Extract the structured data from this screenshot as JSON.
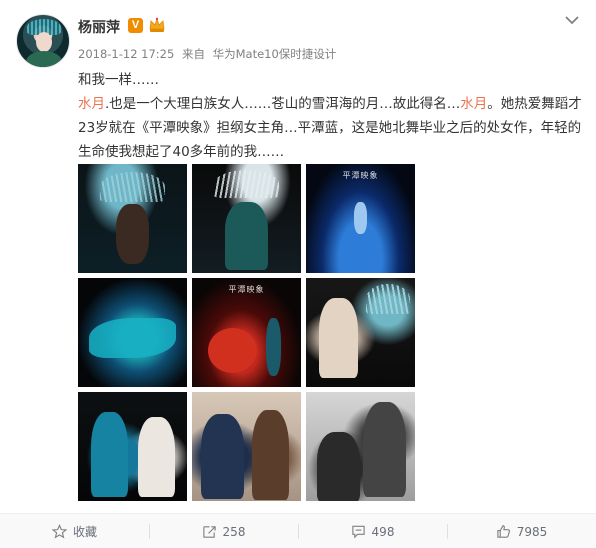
{
  "post": {
    "user_name": "杨丽萍",
    "verified_mark": "V",
    "meta": {
      "time": "2018-1-12 17:25",
      "source_prefix": "来自",
      "device": "华为Mate10保时捷设计"
    },
    "text": {
      "line1": "和我一样……",
      "hl1": "水月",
      "part2": ".也是一个大理白族女人……苍山的雪洱海的月…故此得名…",
      "hl2": "水月",
      "part3": "。她热爱舞蹈才23岁就在《平潭映象》担纲女主角…平潭蓝，这是她北舞毕业之后的处女作，年轻的生命使我想起了40多年前的我……"
    },
    "photos": [
      {
        "name": "photo-1"
      },
      {
        "name": "photo-2"
      },
      {
        "name": "photo-3",
        "caption": "平潭映象"
      },
      {
        "name": "photo-4"
      },
      {
        "name": "photo-5",
        "caption": "平潭映象"
      },
      {
        "name": "photo-6"
      },
      {
        "name": "photo-7"
      },
      {
        "name": "photo-8"
      },
      {
        "name": "photo-9"
      }
    ]
  },
  "actions": {
    "favorite": "收藏",
    "repost": "258",
    "comment": "498",
    "like": "7985"
  },
  "colors": {
    "highlight": "#eb7350",
    "badge": "#f08c00",
    "meta_text": "#808080",
    "action_text": "#696e78"
  },
  "icons": [
    "chevron-down-icon",
    "star-icon",
    "share-icon",
    "comment-icon",
    "thumbs-up-icon",
    "crown-badge-icon"
  ]
}
